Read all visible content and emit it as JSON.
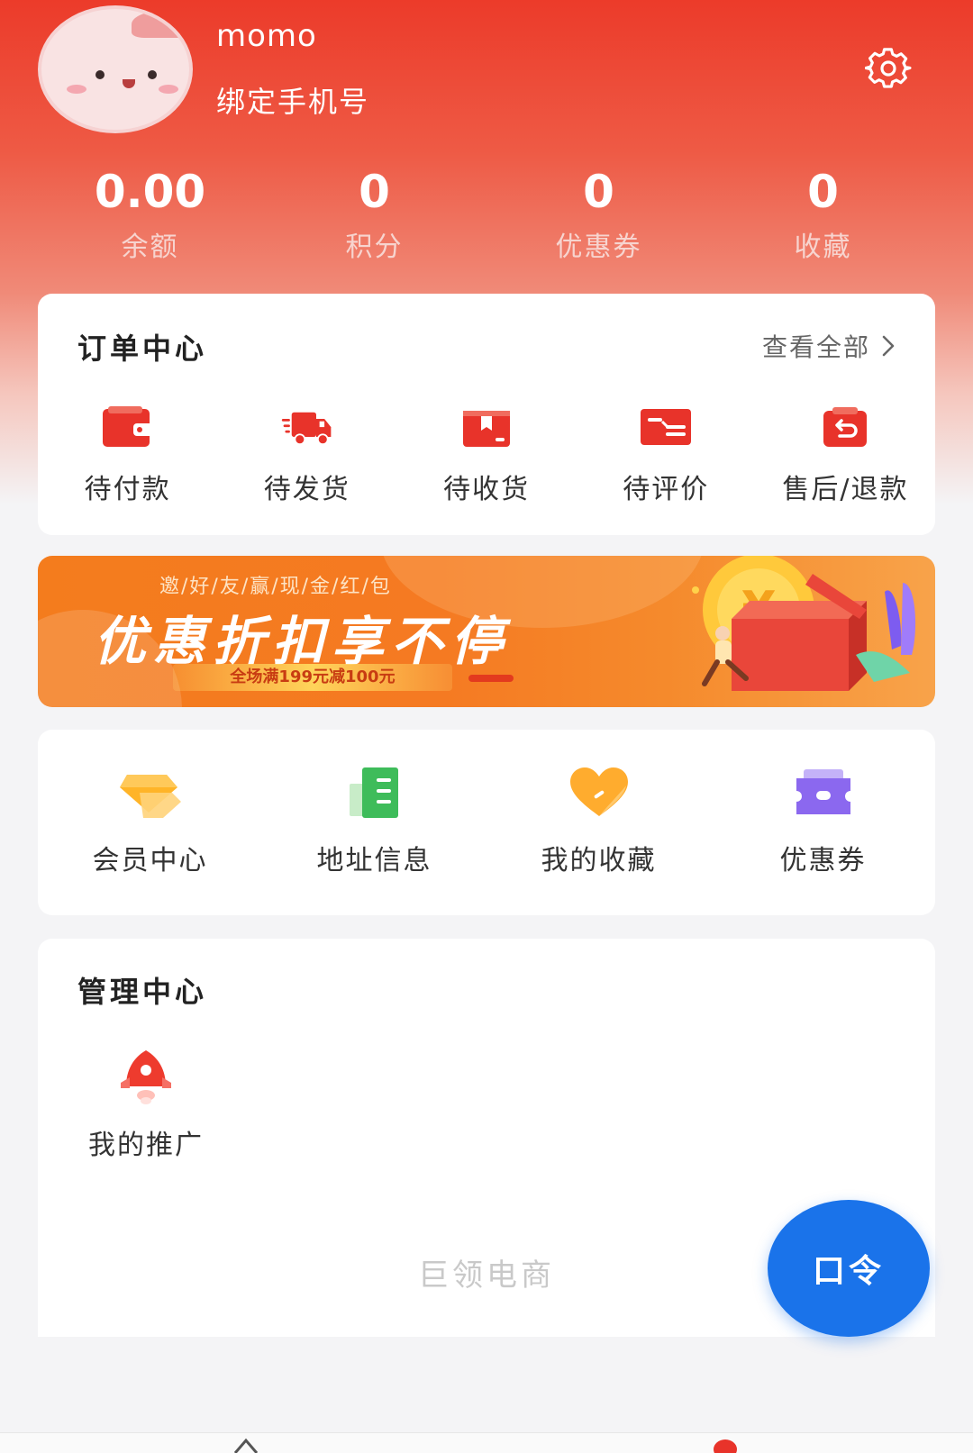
{
  "user": {
    "name": "momo",
    "bind_phone": "绑定手机号"
  },
  "stats": [
    {
      "value": "0.00",
      "label": "余额"
    },
    {
      "value": "0",
      "label": "积分"
    },
    {
      "value": "0",
      "label": "优惠券"
    },
    {
      "value": "0",
      "label": "收藏"
    }
  ],
  "orders": {
    "title": "订单中心",
    "view_all": "查看全部",
    "items": [
      {
        "label": "待付款",
        "icon": "wallet-icon"
      },
      {
        "label": "待发货",
        "icon": "truck-icon"
      },
      {
        "label": "待收货",
        "icon": "package-icon"
      },
      {
        "label": "待评价",
        "icon": "review-card-icon"
      },
      {
        "label": "售后/退款",
        "icon": "refund-icon"
      }
    ]
  },
  "banner": {
    "subtitle": "邀/好/友/赢/现/金/红/包",
    "headline": "优惠折扣享不停",
    "promo": "全场满199元减100元"
  },
  "quick": [
    {
      "label": "会员中心",
      "icon": "diamond-icon"
    },
    {
      "label": "地址信息",
      "icon": "address-book-icon"
    },
    {
      "label": "我的收藏",
      "icon": "heart-icon"
    },
    {
      "label": "优惠券",
      "icon": "coupon-icon"
    }
  ],
  "manage": {
    "title": "管理中心",
    "items": [
      {
        "label": "我的推广",
        "icon": "rocket-icon"
      }
    ]
  },
  "footer": {
    "brand": "巨领电商"
  },
  "fab": {
    "label": "口令"
  },
  "colors": {
    "header_red": "#ec3b2a",
    "order_icon_red": "#e8332a",
    "fab_blue": "#1a73ea",
    "banner_orange": "#f47c1d"
  }
}
